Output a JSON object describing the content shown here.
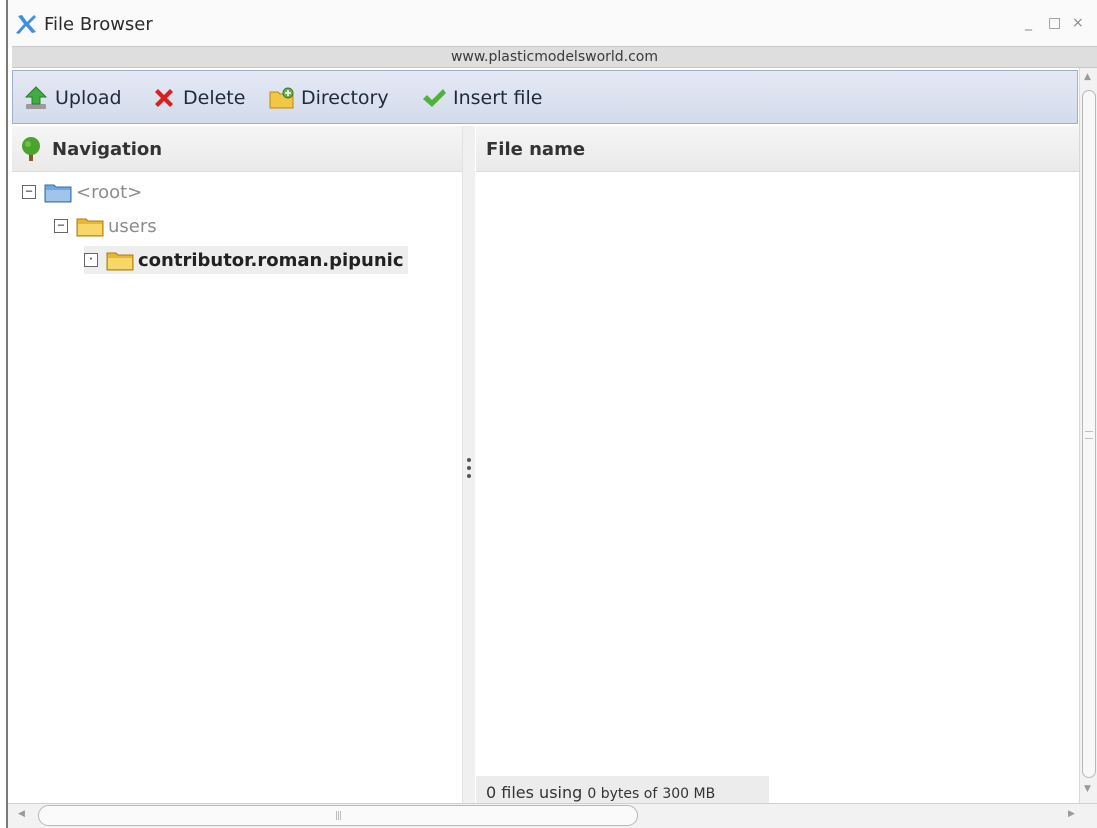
{
  "window": {
    "title": "File Browser",
    "controls": {
      "minimize": "_",
      "maximize": "□",
      "close": "×"
    }
  },
  "url": "www.plasticmodelsworld.com",
  "toolbar": {
    "upload": "Upload",
    "delete": "Delete",
    "directory": "Directory",
    "insert": "Insert file"
  },
  "navigation": {
    "header": "Navigation",
    "tree": [
      {
        "label": "<root>",
        "toggle": "−"
      },
      {
        "label": "users",
        "toggle": "−"
      },
      {
        "label": "contributor.roman.pipunic",
        "toggle": "·"
      }
    ]
  },
  "files": {
    "header": "File name",
    "status_count": "0 files using",
    "status_bytes": "0 bytes of",
    "status_quota": "300 MB"
  },
  "colors": {
    "toolbar_bg": "#d3dbeb",
    "folder_yellow": "#f2c744",
    "folder_blue": "#6fa8dc"
  }
}
